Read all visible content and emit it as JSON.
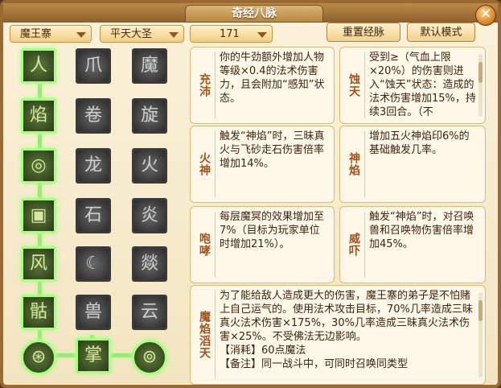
{
  "window": {
    "title": "奇经八脉",
    "close_glyph": "✕"
  },
  "toolbar": {
    "school": "魔王寨",
    "faction": "平天大圣",
    "points": "171",
    "reset_label": "重置经脉",
    "default_label": "默认模式"
  },
  "tree": {
    "rows": [
      [
        {
          "icon": "figure-icon",
          "on": true
        },
        {
          "icon": "claw-icon",
          "on": false
        },
        {
          "icon": "demon-face-icon",
          "on": false
        }
      ],
      [
        {
          "icon": "flame-figure-icon",
          "on": true
        },
        {
          "icon": "scroll-icon",
          "on": false
        },
        {
          "icon": "swirl-icon",
          "on": false
        }
      ],
      [
        {
          "icon": "rune-circle-icon",
          "on": true
        },
        {
          "icon": "dragon-icon",
          "on": false
        },
        {
          "icon": "fire-icon",
          "on": false
        }
      ],
      [
        {
          "icon": "rune-square-icon",
          "on": true
        },
        {
          "icon": "rock-icon",
          "on": false
        },
        {
          "icon": "fire-burst-icon",
          "on": false
        }
      ],
      [
        {
          "icon": "wind-icon",
          "on": true
        },
        {
          "icon": "crescent-icon",
          "on": false
        },
        {
          "icon": "flame-storm-icon",
          "on": false
        }
      ],
      [
        {
          "icon": "flame-skull-icon",
          "on": true
        },
        {
          "icon": "beast-icon",
          "on": false
        },
        {
          "icon": "cloud-icon",
          "on": false
        }
      ]
    ],
    "bottom": [
      {
        "icon": "swirl-orb-icon"
      },
      {
        "icon": "hand-flame-icon"
      },
      {
        "icon": "spiral-orb-icon"
      }
    ]
  },
  "cards": [
    {
      "name": "充沛",
      "desc": "你的牛劲额外增加人物等级×0.4的法术伤害力，且会附加“感知”状态。"
    },
    {
      "name": "蚀天",
      "desc": "受到≥（气血上限×20%）的伤害则进入“蚀天”状态：造成的法术伤害增加15%，持续3回合。（不"
    },
    {
      "name": "火神",
      "desc": "触发“神焰”时，三昧真火与飞砂走石伤害倍率增加14%。"
    },
    {
      "name": "神焰",
      "desc": "增加五火神焰印6%的基础触发几率。"
    },
    {
      "name": "咆哮",
      "desc": "每层魔冥的效果增加至7%（目标为玩家单位时增加21%）。"
    },
    {
      "name": "威吓",
      "desc": "触发“神焰”时，对召唤兽和召唤物伤害倍率增加45%。"
    },
    {
      "name": "魔焰滔天",
      "desc": "为了能给敌人造成更大的伤害，魔王寨的弟子是不怕赌上自己运气的。使用法术攻击目标，70%几率造成三昧真火法术伤害×175%，30%几率造成三昧真火法术伤害×25%。不受佛法无边影响。\n【消耗】60点魔法\n【备注】同一战斗中，可同时召唤同类型"
    }
  ]
}
